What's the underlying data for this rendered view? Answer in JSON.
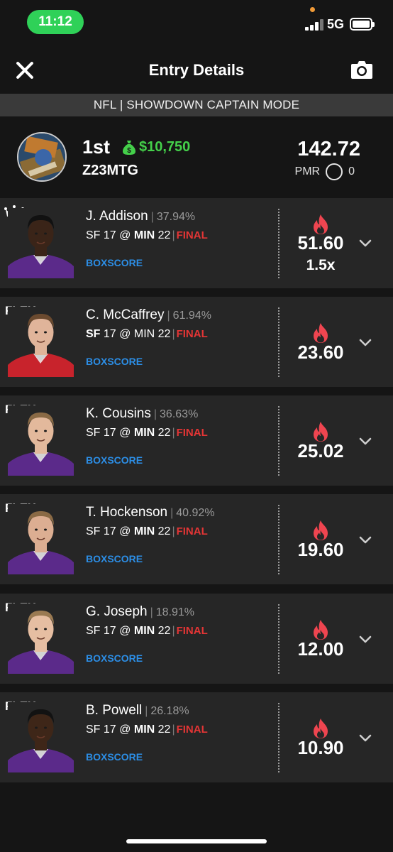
{
  "status_bar": {
    "time": "11:12",
    "network": "5G"
  },
  "header": {
    "title": "Entry Details"
  },
  "mode": "NFL | SHOWDOWN CAPTAIN MODE",
  "entry": {
    "place": "1st",
    "winnings": "$10,750",
    "username": "Z23MTG",
    "total_points": "142.72",
    "pmr_label": "PMR",
    "pmr_value": "0"
  },
  "players": [
    {
      "slot": "",
      "is_captain": true,
      "name": "J. Addison",
      "ownership": "37.94%",
      "away": "SF",
      "away_score": "17",
      "at": "@",
      "home": "MIN",
      "home_score": "22",
      "bold_team": "home",
      "status": "FINAL",
      "boxscore": "BOXSCORE",
      "points": "51.60",
      "multiplier": "1.5x",
      "jersey": "#5b2a8a",
      "skin": "#3a2418",
      "hair": "#111111"
    },
    {
      "slot": "FLEX",
      "is_captain": false,
      "name": "C. McCaffrey",
      "ownership": "61.94%",
      "away": "SF",
      "away_score": "17",
      "at": "@",
      "home": "MIN",
      "home_score": "22",
      "bold_team": "away",
      "status": "FINAL",
      "boxscore": "BOXSCORE",
      "points": "23.60",
      "multiplier": "",
      "jersey": "#c8232c",
      "skin": "#e0b49a",
      "hair": "#6b4a2f"
    },
    {
      "slot": "FLEX",
      "is_captain": false,
      "name": "K. Cousins",
      "ownership": "36.63%",
      "away": "SF",
      "away_score": "17",
      "at": "@",
      "home": "MIN",
      "home_score": "22",
      "bold_team": "home",
      "status": "FINAL",
      "boxscore": "BOXSCORE",
      "points": "25.02",
      "multiplier": "",
      "jersey": "#5b2a8a",
      "skin": "#e3b99c",
      "hair": "#8a6a45"
    },
    {
      "slot": "FLEX",
      "is_captain": false,
      "name": "T. Hockenson",
      "ownership": "40.92%",
      "away": "SF",
      "away_score": "17",
      "at": "@",
      "home": "MIN",
      "home_score": "22",
      "bold_team": "home",
      "status": "FINAL",
      "boxscore": "BOXSCORE",
      "points": "19.60",
      "multiplier": "",
      "jersey": "#5b2a8a",
      "skin": "#dcae92",
      "hair": "#8a6a45"
    },
    {
      "slot": "FLEX",
      "is_captain": false,
      "name": "G. Joseph",
      "ownership": "18.91%",
      "away": "SF",
      "away_score": "17",
      "at": "@",
      "home": "MIN",
      "home_score": "22",
      "bold_team": "home",
      "status": "FINAL",
      "boxscore": "BOXSCORE",
      "points": "12.00",
      "multiplier": "",
      "jersey": "#5b2a8a",
      "skin": "#e6bea2",
      "hair": "#9a7a52"
    },
    {
      "slot": "FLEX",
      "is_captain": false,
      "name": "B. Powell",
      "ownership": "26.18%",
      "away": "SF",
      "away_score": "17",
      "at": "@",
      "home": "MIN",
      "home_score": "22",
      "bold_team": "home",
      "status": "FINAL",
      "boxscore": "BOXSCORE",
      "points": "10.90",
      "multiplier": "",
      "jersey": "#5b2a8a",
      "skin": "#3e2618",
      "hair": "#121212"
    }
  ],
  "colors": {
    "background": "#151515",
    "card": "#262626",
    "accent_green": "#44d04a",
    "final_red": "#e53535",
    "flame_red": "#ef4550",
    "link_blue": "#2c8ee6",
    "status_green": "#2fd158"
  },
  "icons": [
    "close-icon",
    "camera-icon",
    "money-bag-icon",
    "crown-icon",
    "flame-icon",
    "chevron-down-icon",
    "signal-icon",
    "battery-icon"
  ]
}
